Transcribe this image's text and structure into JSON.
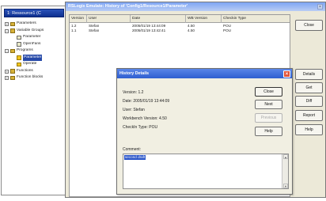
{
  "tree_window": {
    "title": "1: Ressource1 (C",
    "items": [
      {
        "label": "Parameters",
        "toggle": "+"
      },
      {
        "label": "Variable Groups",
        "toggle": "−"
      },
      {
        "label": "Parameter"
      },
      {
        "label": "OpenFans"
      },
      {
        "label": "Programs",
        "toggle": "−"
      },
      {
        "label": "Parameter"
      },
      {
        "label": "Operate"
      },
      {
        "label": "Functions",
        "toggle": "+"
      },
      {
        "label": "Function blocks",
        "toggle": "+"
      }
    ]
  },
  "history_window": {
    "title": "RSLogix Emulate: History of 'Config1/Resource1/Parameter'",
    "close_glyph": "×",
    "columns": [
      "Version",
      "User",
      "Date",
      "WB Version",
      "Checkin Type"
    ],
    "rows": [
      [
        "1.2",
        "Stefan",
        "2005/01/19 13:44:09",
        "4.50",
        "POU"
      ],
      [
        "1.1",
        "Stefan",
        "2005/01/19 13:42:41",
        "4.50",
        "POU"
      ]
    ],
    "buttons": {
      "close": "Close",
      "details": "Details",
      "get": "Get",
      "diff": "Diff",
      "report": "Report",
      "help": "Help"
    }
  },
  "details_window": {
    "title": "History Details",
    "close_glyph": "×",
    "version": "Version: 1.2",
    "date": "Date: 2005/01/19 13:44:09",
    "user": "User: Stefan",
    "workbench_version": "Workbench Version: 4.50",
    "checkin_type": "CheckIn Type: POU",
    "comment_label": "Comment:",
    "comment_value": "second draft",
    "buttons": {
      "close": "Close",
      "next": "Next",
      "previous": "Previous",
      "help": "Help"
    }
  },
  "colors": {
    "title_active": "#2f5fd0",
    "title_inactive": "#7da5f4",
    "close_red": "#e2543a",
    "selection": "#2649a8"
  }
}
